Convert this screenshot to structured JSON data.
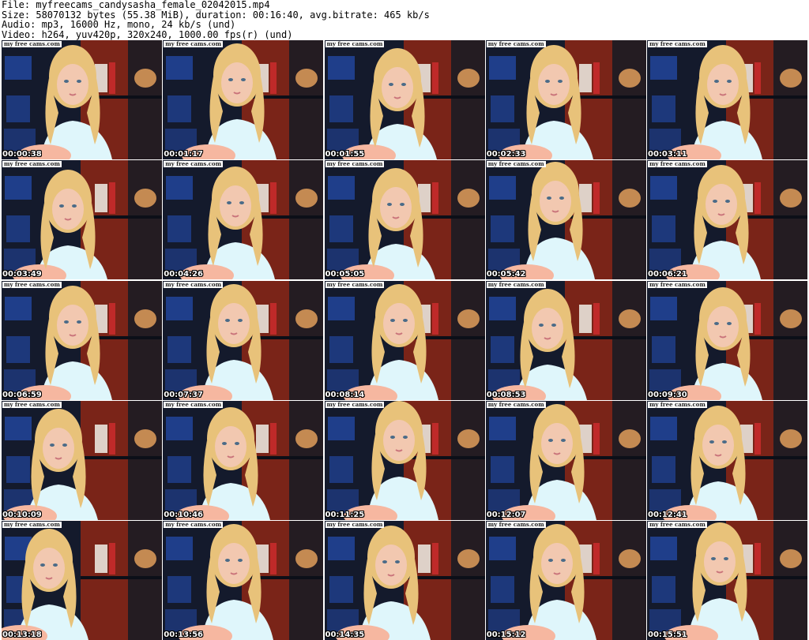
{
  "header": {
    "file_line": "File: myfreecams_candysasha_female_02042015.mp4",
    "size_line": "Size: 58070132 bytes (55.38 MiB), duration: 00:16:40, avg.bitrate: 465 kb/s",
    "audio_line": "Audio: mp3, 16000 Hz, mono, 24 kb/s (und)",
    "video_line": "Video: h264, yuv420p, 320x240, 1000.00 fps(r) (und)"
  },
  "watermark": "my free cams.com",
  "thumbnails": [
    {
      "timestamp": "00:00:38"
    },
    {
      "timestamp": "00:01:17"
    },
    {
      "timestamp": "00:01:55"
    },
    {
      "timestamp": "00:02:33"
    },
    {
      "timestamp": "00:03:11"
    },
    {
      "timestamp": "00:03:49"
    },
    {
      "timestamp": "00:04:26"
    },
    {
      "timestamp": "00:05:05"
    },
    {
      "timestamp": "00:05:42"
    },
    {
      "timestamp": "00:06:21"
    },
    {
      "timestamp": "00:06:59"
    },
    {
      "timestamp": "00:07:37"
    },
    {
      "timestamp": "00:08:14"
    },
    {
      "timestamp": "00:08:53"
    },
    {
      "timestamp": "00:09:30"
    },
    {
      "timestamp": "00:10:09"
    },
    {
      "timestamp": "00:10:46"
    },
    {
      "timestamp": "00:11:25"
    },
    {
      "timestamp": "00:12:07"
    },
    {
      "timestamp": "00:12:41"
    },
    {
      "timestamp": "00:13:18"
    },
    {
      "timestamp": "00:13:56"
    },
    {
      "timestamp": "00:14:35"
    },
    {
      "timestamp": "00:15:12"
    },
    {
      "timestamp": "00:15:51"
    }
  ],
  "colors": {
    "background": "#ffffff",
    "wall_red": "#7a2418",
    "shelf_dark": "#141a2c",
    "shelf_blue": "#1f3e8a",
    "hair": "#e8c27a",
    "skin": "#f2c8b0",
    "sweater": "#dff6fb"
  }
}
